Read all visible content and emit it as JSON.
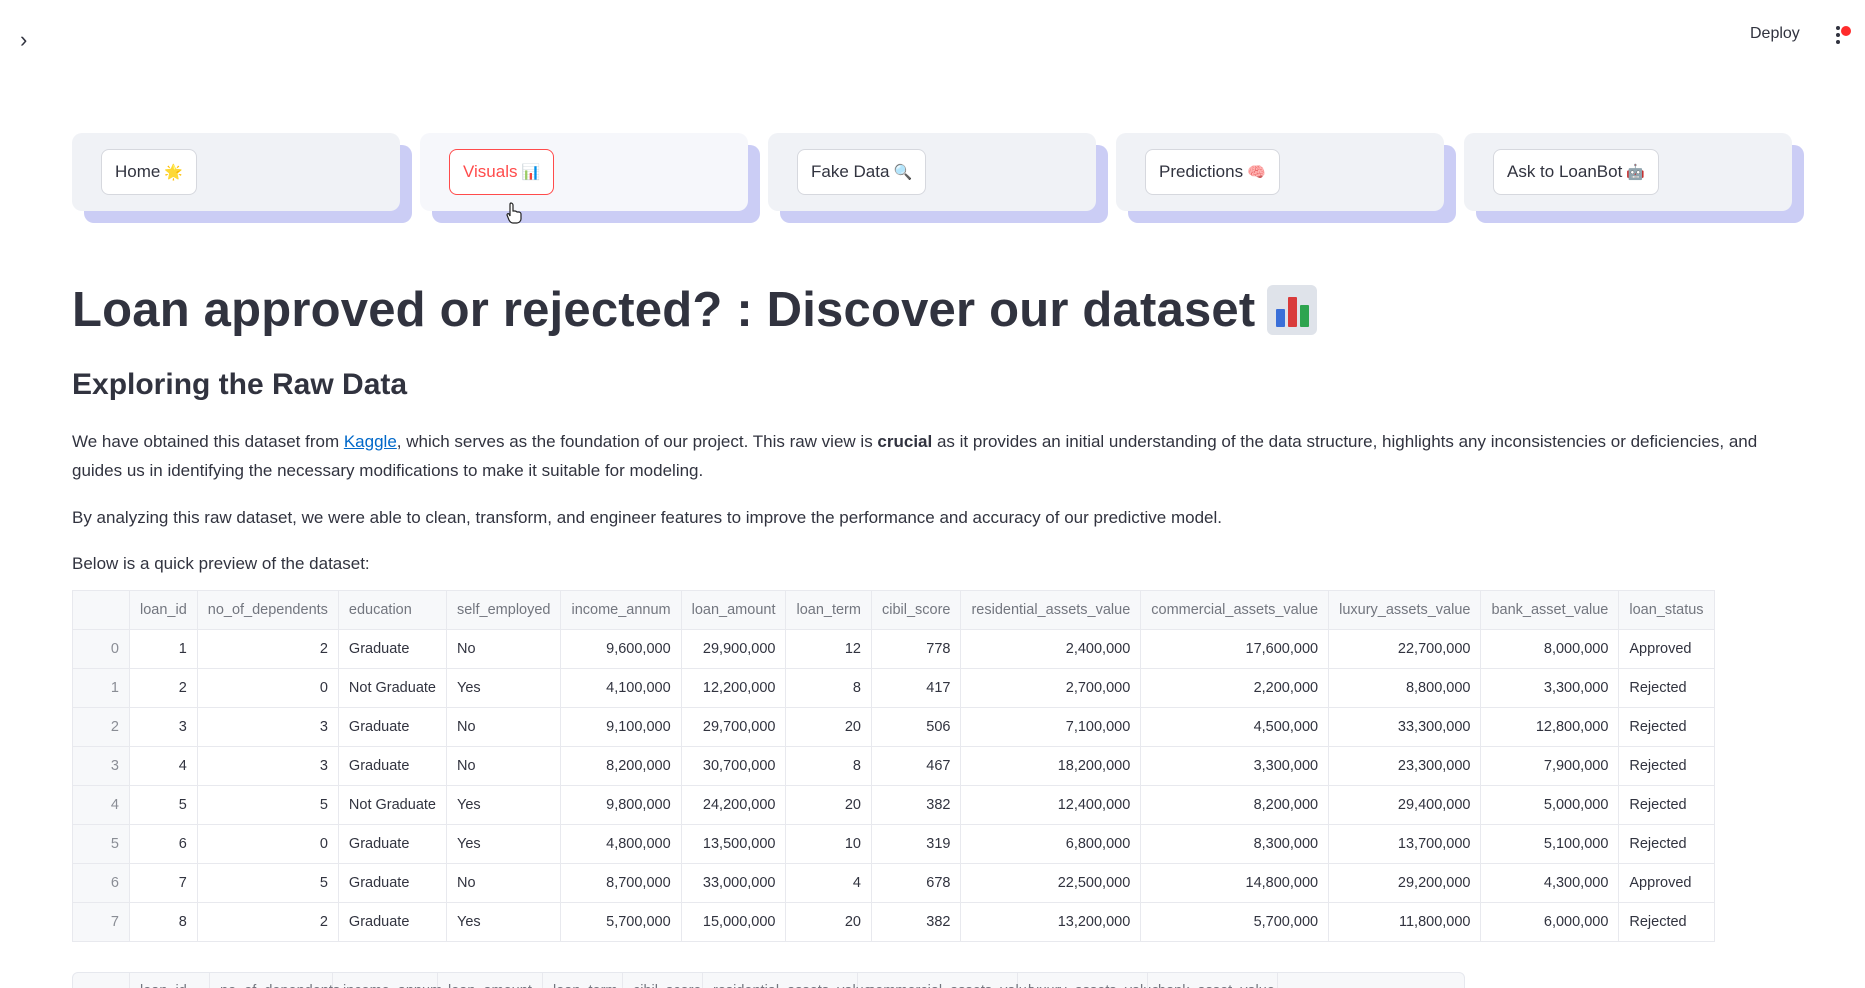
{
  "topbar": {
    "expand_glyph": "›",
    "deploy_label": "Deploy",
    "menu_icon": "kebab-menu-icon"
  },
  "nav": [
    {
      "label": "Home",
      "emoji": "🌟",
      "active": false
    },
    {
      "label": "Visuals",
      "emoji": "📊",
      "active": true
    },
    {
      "label": "Fake Data",
      "emoji": "🔍",
      "active": false
    },
    {
      "label": "Predictions",
      "emoji": "🧠",
      "active": false
    },
    {
      "label": "Ask to LoanBot",
      "emoji": "🤖",
      "active": false
    }
  ],
  "page": {
    "title": "Loan approved or rejected? : Discover our dataset",
    "subtitle": "Exploring the Raw Data",
    "p1_before": "We have obtained this dataset from ",
    "p1_link": "Kaggle",
    "p1_mid": ", which serves as the foundation of our project. This raw view is ",
    "p1_bold": "crucial",
    "p1_after": " as it provides an initial understanding of the data structure, highlights any inconsistencies or deficiencies, and guides us in identifying the necessary modifications to make it suitable for modeling.",
    "p2": "By analyzing this raw dataset, we were able to clean, transform, and engineer features to improve the performance and accuracy of our predictive model.",
    "p3": "Below is a quick preview of the dataset:"
  },
  "table": {
    "columns": [
      "",
      "loan_id",
      "no_of_dependents",
      "education",
      "self_employed",
      "income_annum",
      "loan_amount",
      "loan_term",
      "cibil_score",
      "residential_assets_value",
      "commercial_assets_value",
      "luxury_assets_value",
      "bank_asset_value",
      "loan_status"
    ],
    "rows": [
      [
        "0",
        "1",
        "2",
        "Graduate",
        "No",
        "9,600,000",
        "29,900,000",
        "12",
        "778",
        "2,400,000",
        "17,600,000",
        "22,700,000",
        "8,000,000",
        "Approved"
      ],
      [
        "1",
        "2",
        "0",
        "Not Graduate",
        "Yes",
        "4,100,000",
        "12,200,000",
        "8",
        "417",
        "2,700,000",
        "2,200,000",
        "8,800,000",
        "3,300,000",
        "Rejected"
      ],
      [
        "2",
        "3",
        "3",
        "Graduate",
        "No",
        "9,100,000",
        "29,700,000",
        "20",
        "506",
        "7,100,000",
        "4,500,000",
        "33,300,000",
        "12,800,000",
        "Rejected"
      ],
      [
        "3",
        "4",
        "3",
        "Graduate",
        "No",
        "8,200,000",
        "30,700,000",
        "8",
        "467",
        "18,200,000",
        "3,300,000",
        "23,300,000",
        "7,900,000",
        "Rejected"
      ],
      [
        "4",
        "5",
        "5",
        "Not Graduate",
        "Yes",
        "9,800,000",
        "24,200,000",
        "20",
        "382",
        "12,400,000",
        "8,200,000",
        "29,400,000",
        "5,000,000",
        "Rejected"
      ],
      [
        "5",
        "6",
        "0",
        "Graduate",
        "Yes",
        "4,800,000",
        "13,500,000",
        "10",
        "319",
        "6,800,000",
        "8,300,000",
        "13,700,000",
        "5,100,000",
        "Rejected"
      ],
      [
        "6",
        "7",
        "5",
        "Graduate",
        "No",
        "8,700,000",
        "33,000,000",
        "4",
        "678",
        "22,500,000",
        "14,800,000",
        "29,200,000",
        "4,300,000",
        "Approved"
      ],
      [
        "7",
        "8",
        "2",
        "Graduate",
        "Yes",
        "5,700,000",
        "15,000,000",
        "20",
        "382",
        "13,200,000",
        "5,700,000",
        "11,800,000",
        "6,000,000",
        "Rejected"
      ]
    ],
    "text_columns": [
      3,
      4,
      13
    ]
  },
  "table2": {
    "columns": [
      "",
      "loan_id",
      "no_of_dependents",
      "income_annum",
      "loan_amount",
      "loan_term",
      "cibil_score",
      "residential_assets_value",
      "commercial_assets_value",
      "luxury_assets_value",
      "bank_asset_value"
    ]
  }
}
